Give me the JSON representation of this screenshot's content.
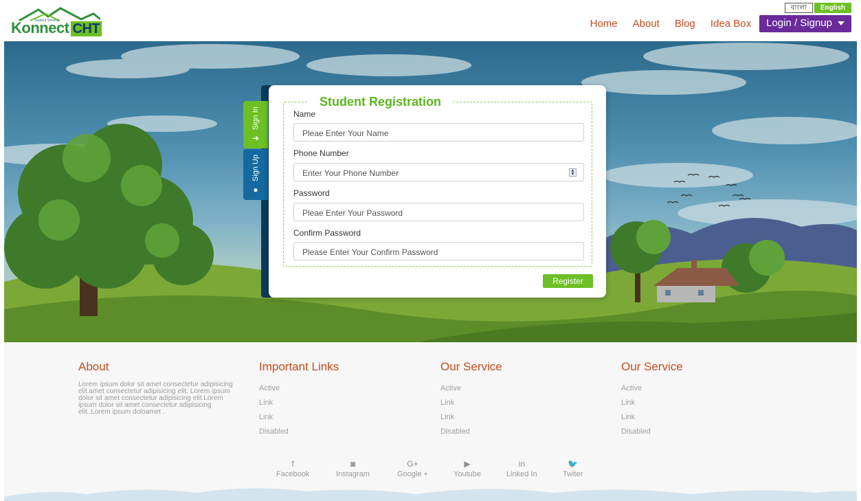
{
  "brand": {
    "logo_text": "Konnect",
    "logo_badge": "CHT",
    "logo_sub": "Student Services"
  },
  "language": {
    "bangla": "বাংলা",
    "english": "English"
  },
  "nav": {
    "items": [
      "Home",
      "About",
      "Blog",
      "Idea Box"
    ],
    "login": "Login / Signup"
  },
  "tabs": {
    "sign_in": "Sign In",
    "sign_up": "Sign Up"
  },
  "form": {
    "title": "Student Registration",
    "name_label": "Name",
    "name_placeholder": "Pleae Enter Your Name",
    "phone_label": "Phone Number",
    "phone_placeholder": "Enter Your Phone Number",
    "password_label": "Password",
    "password_placeholder": "Pleae Enter Your Password",
    "confirm_label": "Confirm Password",
    "confirm_placeholder": "Please Enter Your Confirm Password",
    "submit": "Register"
  },
  "footer": {
    "about": {
      "title": "About",
      "text": "Lorem ipsum dolor sit amet consectetur adipisicing elit.amet consectetur adipisicing elit. Lorem ipsum dolor sit amet consectetur adipisicing elit.Lorem ipsum dolor sit amet consectetur adipisicing elit..Lorem ipsum doloamet ."
    },
    "important_links": {
      "title": "Important Links",
      "links": [
        "Active",
        "Link",
        "Link",
        "Disabled"
      ]
    },
    "service_1": {
      "title": "Our Service",
      "links": [
        "Active",
        "Link",
        "Link",
        "Disabled"
      ]
    },
    "service_2": {
      "title": "Our Service",
      "links": [
        "Active",
        "Link",
        "Link",
        "Disabled"
      ]
    },
    "social": [
      {
        "icon": "facebook-icon",
        "glyph": "f",
        "label": "Facebook"
      },
      {
        "icon": "instagram-icon",
        "glyph": "◙",
        "label": "Instagram"
      },
      {
        "icon": "google-plus-icon",
        "glyph": "G+",
        "label": "Google +"
      },
      {
        "icon": "youtube-icon",
        "glyph": "▶",
        "label": "Youtube"
      },
      {
        "icon": "linkedin-icon",
        "glyph": "in",
        "label": "Linked In"
      },
      {
        "icon": "twitter-icon",
        "glyph": "🐦",
        "label": "Twiter"
      }
    ]
  },
  "colors": {
    "accent_green": "#6cc024",
    "nav_orange": "#c64a1d",
    "login_purple": "#6a2a9a",
    "tab_blue": "#146aa0"
  }
}
